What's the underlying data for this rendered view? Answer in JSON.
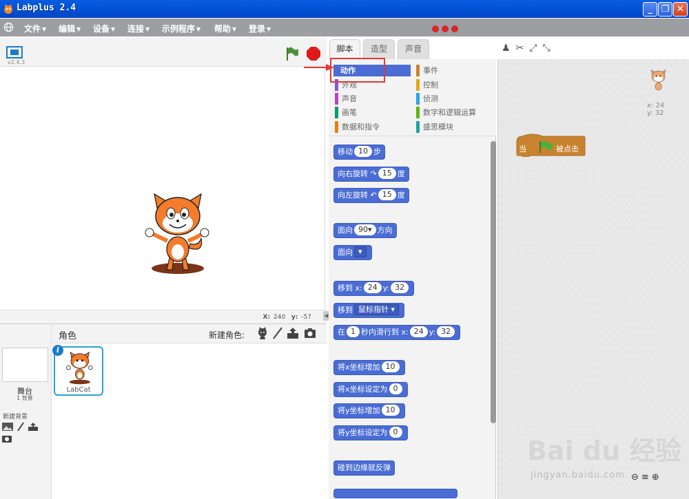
{
  "window": {
    "title": "Labplus 2.4"
  },
  "menubar": {
    "items": [
      "文件",
      "编辑",
      "设备",
      "连接",
      "示例程序",
      "帮助",
      "登录"
    ]
  },
  "stage": {
    "version": "v2.4.3",
    "mouse_x_label": "X:",
    "mouse_x": "240",
    "mouse_y_label": "y:",
    "mouse_y": "-57"
  },
  "sprites_pane": {
    "title": "角色",
    "new_sprite_label": "新建角色:",
    "stage_label": "舞台",
    "backdrop_count": "1 背景",
    "new_backdrop_label": "新建背景",
    "sprite_name": "LabCat"
  },
  "tabs": [
    "脚本",
    "造型",
    "声音"
  ],
  "categories": [
    {
      "label": "动作",
      "color": "#4a6cd4",
      "active": true
    },
    {
      "label": "事件",
      "color": "#c88330",
      "active": false
    },
    {
      "label": "外观",
      "color": "#8a55d7",
      "active": false
    },
    {
      "label": "控制",
      "color": "#e1a91a",
      "active": false
    },
    {
      "label": "声音",
      "color": "#bb42c3",
      "active": false
    },
    {
      "label": "侦测",
      "color": "#2ca5e2",
      "active": false
    },
    {
      "label": "画笔",
      "color": "#0e9a6c",
      "active": false
    },
    {
      "label": "数字和逻辑运算",
      "color": "#5cb712",
      "active": false
    },
    {
      "label": "数据和指令",
      "color": "#ee7d16",
      "active": false
    },
    {
      "label": "盛思模块",
      "color": "#1fa39a",
      "active": false
    }
  ],
  "blocks": {
    "move": {
      "a": "移动",
      "v": "10",
      "b": "步"
    },
    "turn_right": {
      "a": "向右旋转",
      "v": "15",
      "b": "度"
    },
    "turn_left": {
      "a": "向左旋转",
      "v": "15",
      "b": "度"
    },
    "point_dir": {
      "a": "面向",
      "v": "90▾",
      "b": "方向"
    },
    "point_towards": {
      "a": "面向",
      "v": "▾"
    },
    "goto_xy": {
      "a": "移到",
      "xl": "x:",
      "x": "24",
      "yl": "y:",
      "y": "32"
    },
    "goto": {
      "a": "移到",
      "v": "鼠标指针 ▾"
    },
    "glide": {
      "a": "在",
      "t": "1",
      "b": "秒内滑行到",
      "xl": "x:",
      "x": "24",
      "yl": "y:",
      "y": "32"
    },
    "change_x": {
      "a": "将x坐标增加",
      "v": "10"
    },
    "set_x": {
      "a": "将x坐标设定为",
      "v": "0"
    },
    "change_y": {
      "a": "将y坐标增加",
      "v": "10"
    },
    "set_y": {
      "a": "将y坐标设定为",
      "v": "0"
    },
    "bounce": {
      "a": "碰到边缘就反弹"
    }
  },
  "scripts": {
    "hat_a": "当",
    "hat_b": "被点击",
    "sprite_x": "x: 24",
    "sprite_y": "y: 32"
  },
  "watermark": {
    "brand": "Bai du 经验",
    "url": "jingyan.baidu.com"
  },
  "colors": {
    "motion": "#4a6cd4",
    "events": "#c88330",
    "highlight": "#e53935",
    "title_bar": "#0454d8"
  }
}
